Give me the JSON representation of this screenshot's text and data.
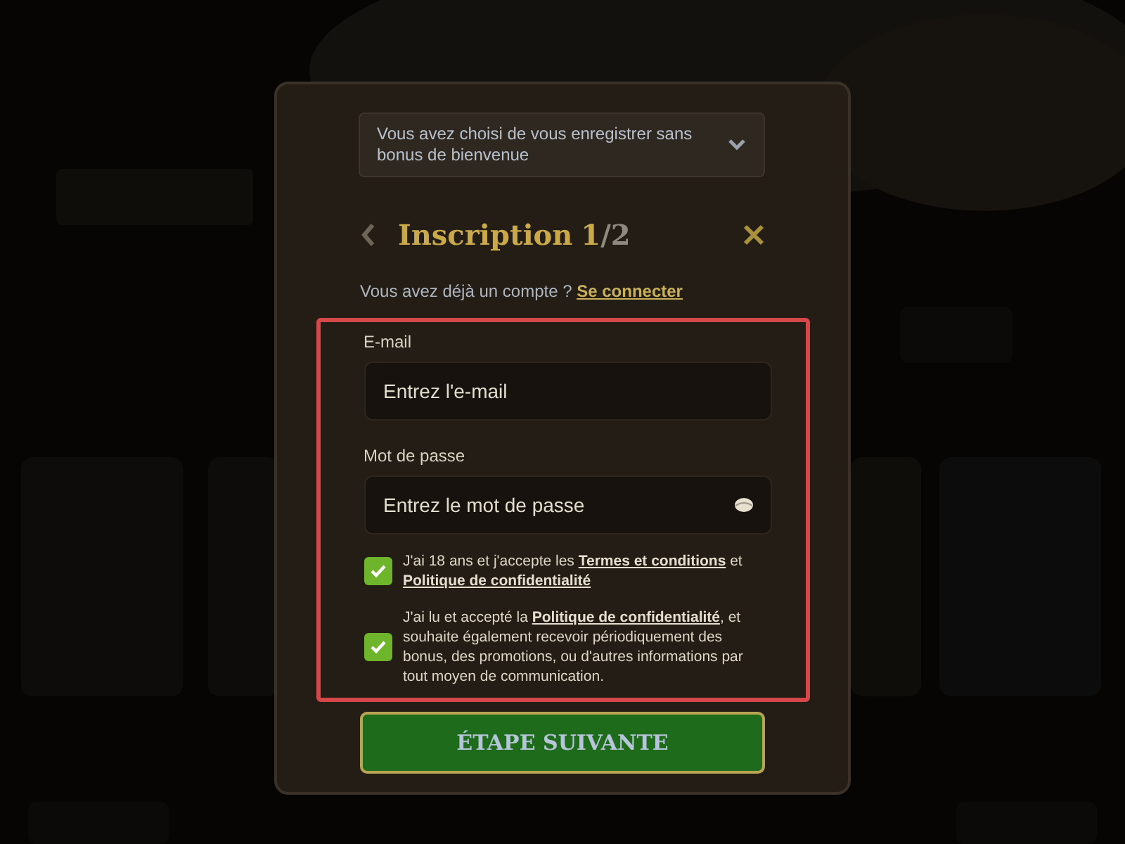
{
  "bonus_select": {
    "text": "Vous avez choisi de vous enregistrer sans bonus de bienvenue",
    "expanded": false
  },
  "header": {
    "title": "Inscription",
    "step_current": "1",
    "step_total": "/2"
  },
  "login_prompt": {
    "text": "Vous avez déjà un compte ?",
    "link": "Se connecter"
  },
  "fields": [
    {
      "label": "E-mail",
      "placeholder": "Entrez l'e-mail",
      "kind": "email"
    },
    {
      "label": "Mot de passe",
      "placeholder": "Entrez le mot de passe",
      "kind": "password"
    }
  ],
  "consents": [
    {
      "checked": true,
      "parts": [
        {
          "text": "J'ai 18 ans et j'accepte les ",
          "link": false
        },
        {
          "text": "Termes et conditions",
          "link": true
        },
        {
          "text": " et ",
          "link": false
        },
        {
          "text": "Politique de confidentialité",
          "link": true
        }
      ]
    },
    {
      "checked": true,
      "parts": [
        {
          "text": "J'ai lu et accepté la ",
          "link": false
        },
        {
          "text": "Politique de confidentialité",
          "link": true
        },
        {
          "text": ", et souhaite également recevoir périodiquement des bonus, des promotions, ou d'autres informations par tout moyen de communication.",
          "link": false
        }
      ]
    }
  ],
  "submit": "ÉTAPE SUIVANTE"
}
